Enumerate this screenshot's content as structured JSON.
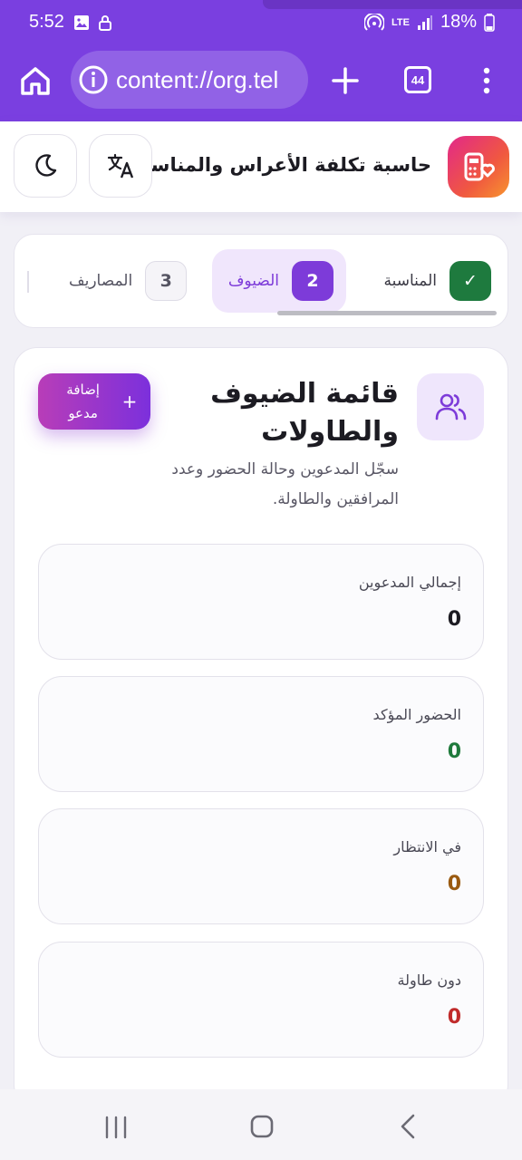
{
  "status_bar": {
    "time": "5:52",
    "network": "LTE",
    "battery": "18%",
    "icons": [
      "image-icon",
      "lock-icon",
      "hotspot-icon",
      "signal-icon",
      "battery-icon"
    ]
  },
  "browser": {
    "url": "content://org.tel",
    "tab_count": "44",
    "color": "#7a3fe0"
  },
  "app": {
    "title": "حاسبة تكلفة الأعراس والمناسبات"
  },
  "stepper": {
    "steps": [
      {
        "num": "✓",
        "label": "المناسبة"
      },
      {
        "num": "2",
        "label": "الضيوف"
      },
      {
        "num": "3",
        "label": "المصاريف"
      }
    ]
  },
  "section": {
    "title": "قائمة الضيوف والطاولات",
    "description": "سجّل المدعوين وحالة الحضور وعدد المرافقين والطاولة.",
    "add_button": "إضافة مدعو",
    "add_button_plus": "+"
  },
  "stats": [
    {
      "label": "إجمالي المدعوين",
      "value": "0",
      "color": "#1c1b22"
    },
    {
      "label": "الحضور المؤكد",
      "value": "0",
      "color": "#1f7a3c"
    },
    {
      "label": "في الانتظار",
      "value": "0",
      "color": "#9a5a10"
    },
    {
      "label": "دون طاولة",
      "value": "0",
      "color": "#c02a2a"
    }
  ]
}
